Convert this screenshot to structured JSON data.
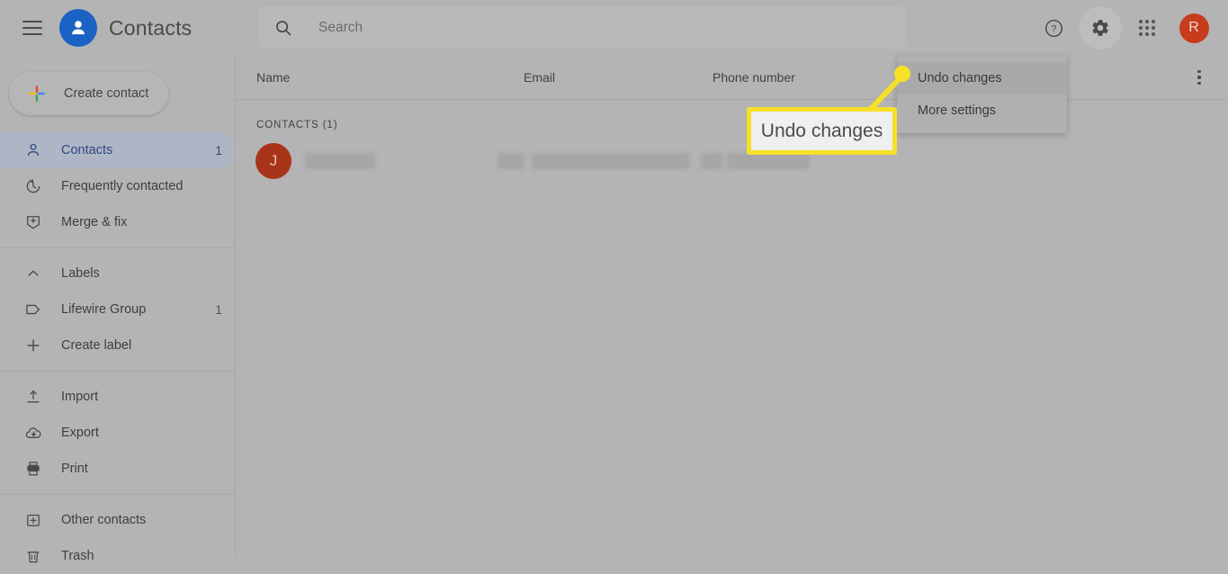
{
  "app": {
    "title": "Contacts",
    "logo_icon": "person-circle-icon",
    "menu_icon": "hamburger-menu-icon"
  },
  "search": {
    "placeholder": "Search",
    "value": "",
    "icon": "search-icon"
  },
  "topbar_actions": [
    {
      "name": "help-icon",
      "label": "Help",
      "glyph": "?"
    },
    {
      "name": "settings-gear-icon",
      "label": "Settings",
      "glyph": "gear",
      "active": true
    },
    {
      "name": "google-apps-icon",
      "label": "Google apps",
      "glyph": "grid"
    },
    {
      "name": "account-avatar",
      "label": "R",
      "color": "#c63c1d"
    }
  ],
  "sidebar": {
    "create_button": {
      "label": "Create contact",
      "icon": "google-plus-icon"
    },
    "primary_items": [
      {
        "label": "Contacts",
        "count": "1",
        "icon": "person-outline-icon",
        "selected": true
      },
      {
        "label": "Frequently contacted",
        "count": "",
        "icon": "history-clock-icon",
        "selected": false
      },
      {
        "label": "Merge & fix",
        "count": "",
        "icon": "merge-fix-icon",
        "selected": false
      }
    ],
    "labels_section": {
      "header": "Labels",
      "collapse_icon": "chevron-up-icon",
      "items": [
        {
          "label": "Lifewire Group",
          "count": "1",
          "icon": "label-tag-icon"
        },
        {
          "label": "Create label",
          "count": "",
          "icon": "plus-icon"
        }
      ]
    },
    "tools_items": [
      {
        "label": "Import",
        "count": "",
        "icon": "upload-icon"
      },
      {
        "label": "Export",
        "count": "",
        "icon": "cloud-download-icon"
      },
      {
        "label": "Print",
        "count": "",
        "icon": "printer-icon"
      }
    ],
    "bottom_items": [
      {
        "label": "Other contacts",
        "count": "",
        "icon": "other-contacts-icon"
      },
      {
        "label": "Trash",
        "count": "",
        "icon": "trash-icon"
      }
    ]
  },
  "table": {
    "columns": {
      "name": "Name",
      "email": "Email",
      "phone": "Phone number"
    },
    "overflow_icon": "more-vertical-icon",
    "section_label": "CONTACTS (1)",
    "rows": [
      {
        "avatar_letter": "J",
        "avatar_color": "#a8341a",
        "name": "",
        "email": "",
        "phone": "",
        "redacted": true
      }
    ]
  },
  "settings_menu": {
    "items": [
      {
        "label": "Undo changes",
        "hovered": true
      },
      {
        "label": "More settings",
        "hovered": false
      }
    ]
  },
  "annotation": {
    "callout_label": "Undo changes",
    "accent_color": "#f7e026",
    "box_fill": "#efefef"
  }
}
